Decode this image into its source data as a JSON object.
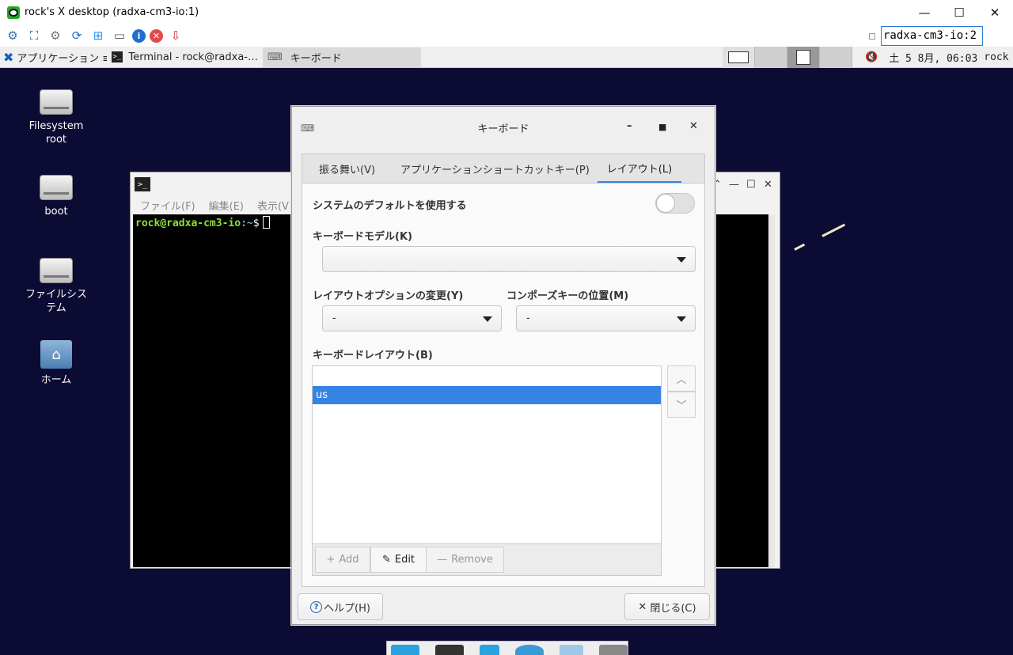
{
  "vnc": {
    "title": "rock's X desktop (radxa-cm3-io:1)",
    "host_field": "radxa-cm3-io:2",
    "controls": {
      "minimize": "—",
      "maximize": "☐",
      "close": "✕"
    },
    "toolbar_icons": [
      "connection-options-icon",
      "fullscreen-icon",
      "settings-icon",
      "refresh-icon",
      "windows-key-icon",
      "ctrl-alt-del-icon",
      "info-icon",
      "disconnect-icon",
      "transfer-icon"
    ]
  },
  "panel": {
    "menu_label": "アプリケーション ≡",
    "tasks": [
      {
        "label": "Terminal - rock@radxa-…",
        "icon": ">_"
      },
      {
        "label": "キーボード",
        "icon": "⌨"
      }
    ],
    "workspaces_count": 4,
    "current_workspace": 3,
    "clock": "土  5  8月, 06:03",
    "user": "rock",
    "volume_icon": "🔇"
  },
  "desktop": {
    "icons": [
      {
        "label": "Filesystem root"
      },
      {
        "label": "boot"
      },
      {
        "label": "ファイルシステム"
      },
      {
        "label": "ホーム"
      }
    ]
  },
  "terminal": {
    "menu": [
      "ファイル(F)",
      "編集(E)",
      "表示(V"
    ],
    "prompt_user": "rock@radxa-cm3-io",
    "prompt_path": ":~",
    "prompt_symbol": "$"
  },
  "keyboard_dialog": {
    "title": "キーボード",
    "tabs": [
      "振る舞い(V)",
      "アプリケーションショートカットキー(P)",
      "レイアウト(L)"
    ],
    "active_tab": 2,
    "use_system_default_label": "システムのデフォルトを使用する",
    "use_system_default_on": false,
    "keyboard_model_label": "キーボードモデル(K)",
    "keyboard_model_value": "",
    "layout_option_label": "レイアウトオプションの変更(Y)",
    "layout_option_value": "-",
    "compose_key_label": "コンポーズキーの位置(M)",
    "compose_key_value": "-",
    "keyboard_layout_label": "キーボードレイアウト(B)",
    "layouts": [
      "us"
    ],
    "selected_layout": "us",
    "add_label": "Add",
    "edit_label": "Edit",
    "remove_label": "Remove",
    "help_label": "ヘルプ(H)",
    "close_label": "閉じる(C)"
  }
}
